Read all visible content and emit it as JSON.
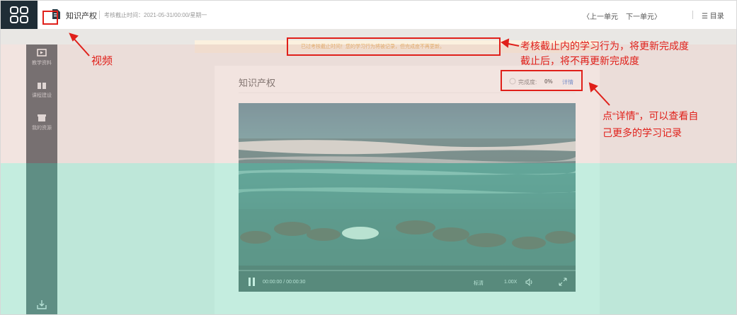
{
  "topbar": {
    "doc_title": "知识产权",
    "deadline": "考核截止时间：2021-05-31/00:00/星期一",
    "prev_unit": "〈上一单元",
    "next_unit": "下一单元〉",
    "toc": "目录"
  },
  "sidebar": {
    "items": [
      {
        "label": "教学资料"
      },
      {
        "label": "课程建设"
      },
      {
        "label": "我的资源"
      }
    ]
  },
  "notice": {
    "text": "已过考核截止时间！您的学习行为将被记录，但完成度不再更新。"
  },
  "content": {
    "title": "知识产权",
    "progress_label": "完成度:",
    "progress_value": "0%",
    "progress_fraction": 0,
    "detail_link": "详情"
  },
  "video": {
    "time": "00:00:00 / 00:00:30",
    "quality": "标清",
    "speed": "1.00X"
  },
  "annotations": {
    "video_label": "视频",
    "notice_label_line1": "考核截止内的学习行为，将更新完成度",
    "notice_label_line2": "截止后，将不再更新完成度",
    "detail_label_line1": "点“详情”，可以查看自",
    "detail_label_line2": "己更多的学习记录",
    "color": "#e0201a"
  },
  "colors": {
    "sidebar_bg": "#1f2d36",
    "link": "#2e6bd6",
    "notice_text": "#e19a34"
  }
}
